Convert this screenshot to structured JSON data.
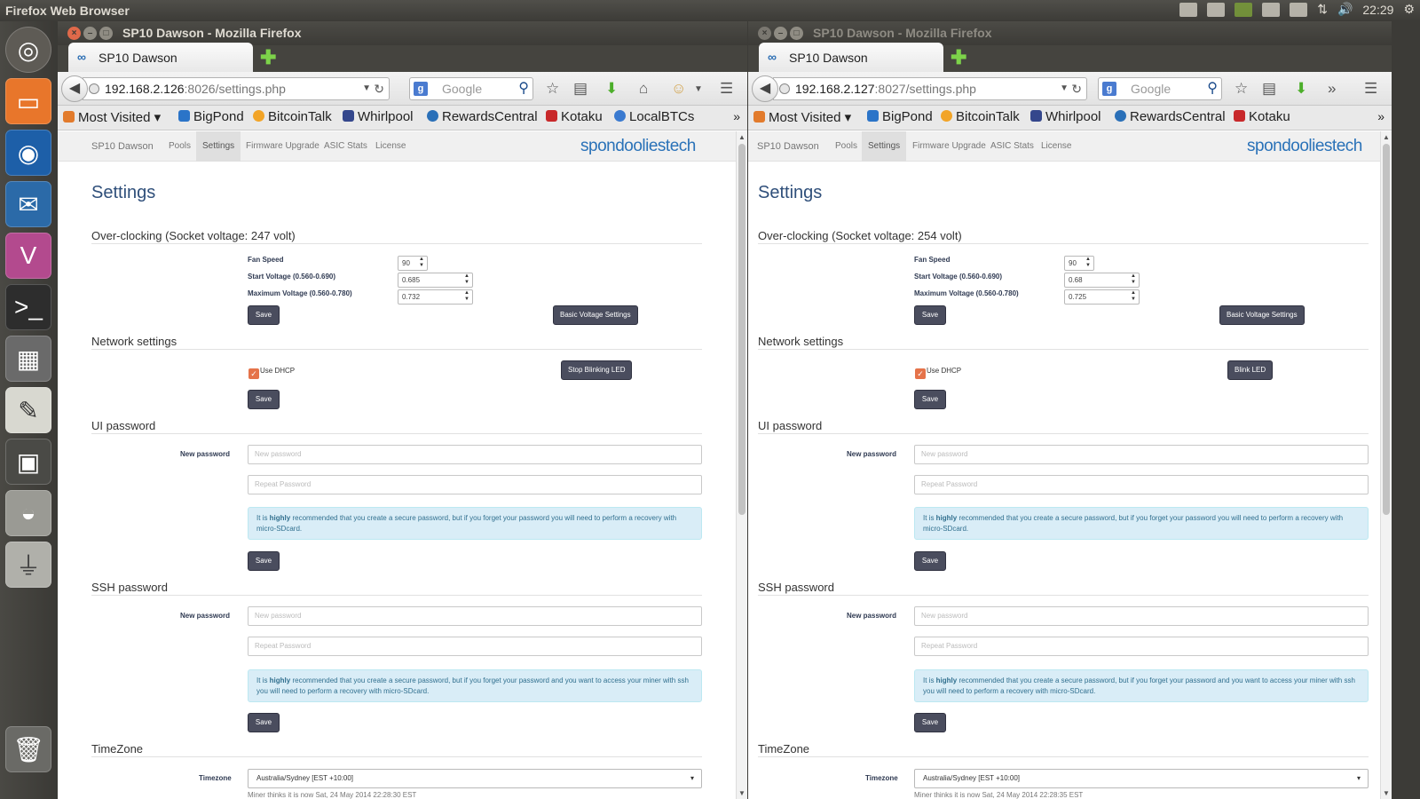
{
  "desktop": {
    "app_title": "Firefox Web Browser",
    "time": "22:29"
  },
  "w1": {
    "window_title": "SP10 Dawson - Mozilla Firefox",
    "tab_title": "SP10 Dawson",
    "url_host": "192.168.2.126",
    "url_rest": ":8026/settings.php",
    "search_placeholder": "Google",
    "bookmarks": [
      "Most Visited",
      "BigPond",
      "BitcoinTalk",
      "Whirlpool",
      "RewardsCentral",
      "Kotaku",
      "LocalBTCs"
    ],
    "nav": [
      "SP10 Dawson",
      "Pools",
      "Settings",
      "Firmware Upgrade",
      "ASIC Stats",
      "License"
    ],
    "brand": "spondooliestech",
    "page_title": "Settings",
    "oc_heading": "Over-clocking (Socket voltage: 247 volt)",
    "fan_label": "Fan Speed",
    "fan_value": "90",
    "start_label": "Start Voltage (0.560-0.690)",
    "start_value": "0.685",
    "max_label": "Maximum Voltage (0.560-0.780)",
    "max_value": "0.732",
    "save": "Save",
    "basic_btn": "Basic Voltage Settings",
    "net_heading": "Network settings",
    "dhcp_label": "Use DHCP",
    "led_btn": "Stop Blinking LED",
    "ui_heading": "UI password",
    "new_pw_label": "New password",
    "new_pw_ph": "New password",
    "repeat_ph": "Repeat Password",
    "ui_alert_pre": "It is ",
    "ui_alert_bold": "highly",
    "ui_alert_post": " recommended that you create a secure password, but if you forget your password you will need to perform a recovery with micro-SDcard.",
    "ssh_heading": "SSH password",
    "ssh_alert_post": " recommended that you create a secure password, but if you forget your password and you want to access your miner with ssh you will need to perform a recovery with micro-SDcard.",
    "tz_heading": "TimeZone",
    "tz_label": "Timezone",
    "tz_value": "Australia/Sydney [EST +10:00]",
    "tz_note": "Miner thinks it is now Sat, 24 May 2014 22:28:30 EST"
  },
  "w2": {
    "window_title": "SP10 Dawson - Mozilla Firefox",
    "tab_title": "SP10 Dawson",
    "url_host": "192.168.2.127",
    "url_rest": ":8027/settings.php",
    "search_placeholder": "Google",
    "bookmarks": [
      "Most Visited",
      "BigPond",
      "BitcoinTalk",
      "Whirlpool",
      "RewardsCentral",
      "Kotaku"
    ],
    "nav": [
      "SP10 Dawson",
      "Pools",
      "Settings",
      "Firmware Upgrade",
      "ASIC Stats",
      "License"
    ],
    "brand": "spondooliestech",
    "page_title": "Settings",
    "oc_heading": "Over-clocking (Socket voltage: 254 volt)",
    "fan_label": "Fan Speed",
    "fan_value": "90",
    "start_label": "Start Voltage (0.560-0.690)",
    "start_value": "0.68",
    "max_label": "Maximum Voltage (0.560-0.780)",
    "max_value": "0.725",
    "save": "Save",
    "basic_btn": "Basic Voltage Settings",
    "net_heading": "Network settings",
    "dhcp_label": "Use DHCP",
    "led_btn": "Blink LED",
    "ui_heading": "UI password",
    "new_pw_label": "New password",
    "new_pw_ph": "New password",
    "repeat_ph": "Repeat Password",
    "ui_alert_pre": "It is ",
    "ui_alert_bold": "highly",
    "ui_alert_post": " recommended that you create a secure password, but if you forget your password you will need to perform a recovery with micro-SDcard.",
    "ssh_heading": "SSH password",
    "ssh_alert_post": " recommended that you create a secure password, but if you forget your password and you want to access your miner with ssh you will need to perform a recovery with micro-SDcard.",
    "tz_heading": "TimeZone",
    "tz_label": "Timezone",
    "tz_value": "Australia/Sydney [EST +10:00]",
    "tz_note": "Miner thinks it is now Sat, 24 May 2014 22:28:35 EST"
  },
  "colors": {
    "accent_button": "#4a4d5e",
    "brand": "#2a72b8",
    "alert_bg": "#d9edf7",
    "checkbox": "#e5734a"
  },
  "launcher_icons": [
    "ubuntu-dash-icon",
    "files-icon",
    "firefox-icon",
    "thunderbird-icon",
    "vlc-icon",
    "terminal-icon",
    "calculator-icon",
    "text-editor-icon",
    "workspace-icon",
    "disk-icon",
    "usb-icon",
    "trash-icon"
  ]
}
